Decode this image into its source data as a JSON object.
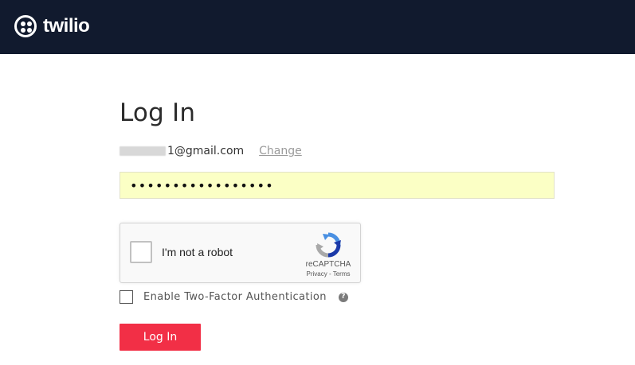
{
  "header": {
    "brand": "twilio",
    "background": "#111a2e"
  },
  "login": {
    "title": "Log In",
    "email_visible": "1@gmail.com",
    "change_link": "Change",
    "password_value": "•••••••••••••••••",
    "password_background": "#fbffc5"
  },
  "recaptcha": {
    "label": "I'm not a robot",
    "brand": "reCAPTCHA",
    "links": "Privacy - Terms",
    "logo_icon": "recaptcha-logo-icon"
  },
  "two_factor": {
    "label": "Enable Two-Factor Authentication",
    "help_icon": "?"
  },
  "submit": {
    "label": "Log In",
    "color": "#f22f46"
  }
}
